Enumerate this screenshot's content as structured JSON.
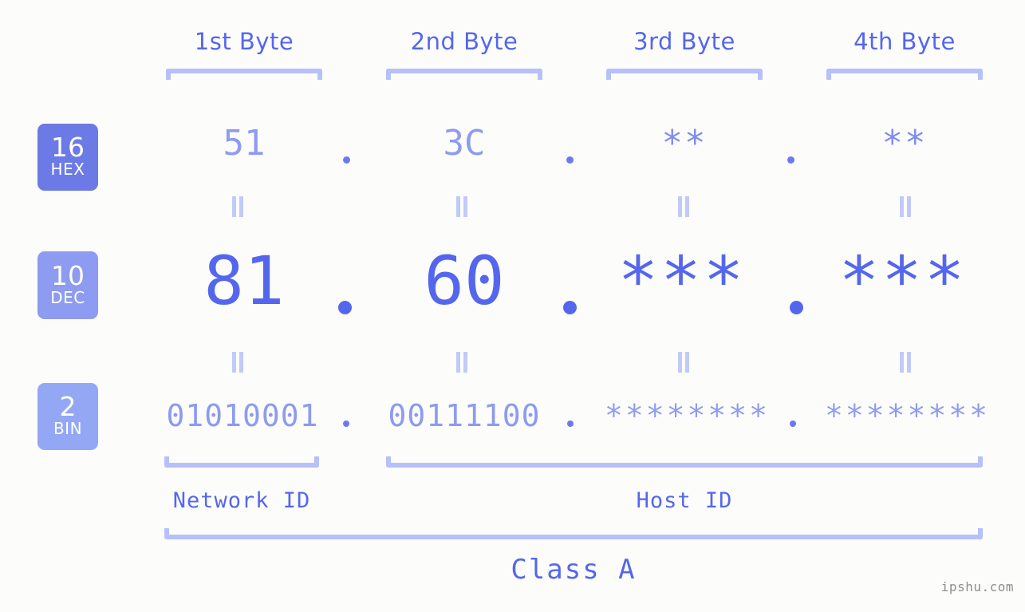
{
  "canvas": {
    "background": "#fcfdfa",
    "accent": "#5566ee",
    "accent_light": "#8e9bf0",
    "bracket_color": "#b6c0fb"
  },
  "header": {
    "byte_labels": [
      {
        "label": "1st Byte"
      },
      {
        "label": "2nd Byte"
      },
      {
        "label": "3rd Byte"
      },
      {
        "label": "4th Byte"
      }
    ]
  },
  "bases": [
    {
      "number": "16",
      "name": "HEX",
      "color": "#6c7ae6"
    },
    {
      "number": "10",
      "name": "DEC",
      "color": "#8d9bf0"
    },
    {
      "number": "2",
      "name": "BIN",
      "color": "#94a7f5"
    }
  ],
  "rows": {
    "hex": {
      "base_number": "16",
      "base_name": "HEX",
      "values": [
        "51",
        "3C",
        "**",
        "**"
      ],
      "separators": [
        ".",
        ".",
        "."
      ]
    },
    "dec": {
      "base_number": "10",
      "base_name": "DEC",
      "values": [
        "81",
        "60",
        "***",
        "***"
      ],
      "separators": [
        ".",
        ".",
        "."
      ]
    },
    "bin": {
      "base_number": "2",
      "base_name": "BIN",
      "values": [
        "01010001",
        "00111100",
        "********",
        "********"
      ],
      "separators": [
        ".",
        ".",
        "."
      ]
    }
  },
  "equality_markers": {
    "glyph": "=",
    "count_per_row": 4,
    "rows": 2
  },
  "footer": {
    "network_id_label": "Network ID",
    "host_id_label": "Host ID",
    "class_label": "Class A",
    "watermark": "ipshu.com"
  },
  "chart_data": {
    "type": "table",
    "title": "IP address byte breakdown by numeral base",
    "columns": [
      "1st Byte",
      "2nd Byte",
      "3rd Byte",
      "4th Byte"
    ],
    "rows": [
      {
        "base": "16 HEX",
        "cells": [
          "51",
          "3C",
          "**",
          "**"
        ]
      },
      {
        "base": "10 DEC",
        "cells": [
          "81",
          "60",
          "***",
          "***"
        ]
      },
      {
        "base": "2 BIN",
        "cells": [
          "01010001",
          "00111100",
          "********",
          "********"
        ]
      }
    ],
    "groupings": [
      {
        "label": "Network ID",
        "columns": [
          "1st Byte"
        ]
      },
      {
        "label": "Host ID",
        "columns": [
          "2nd Byte",
          "3rd Byte",
          "4th Byte"
        ]
      },
      {
        "label": "Class A",
        "columns": [
          "1st Byte",
          "2nd Byte",
          "3rd Byte",
          "4th Byte"
        ]
      }
    ]
  }
}
